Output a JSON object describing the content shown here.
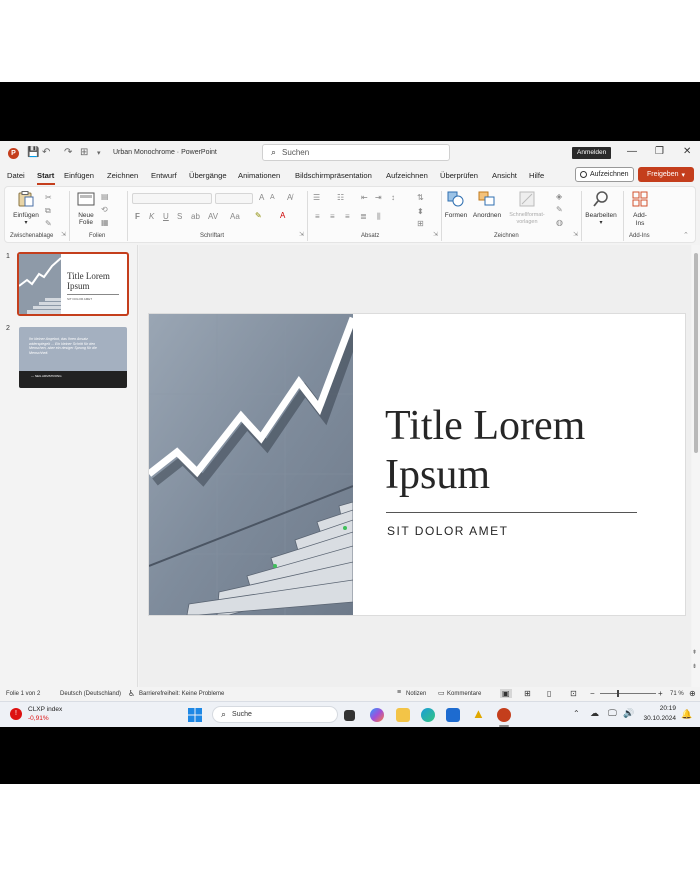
{
  "window": {
    "app_logo_letter": "P",
    "doc_title": "Urban Monochrome  ·  PowerPoint",
    "search_placeholder": "Suchen",
    "signin_label": "Anmelden",
    "minimize": "—",
    "maximize": "❐",
    "close": "✕"
  },
  "menu": {
    "tabs": [
      "Datei",
      "Start",
      "Einfügen",
      "Zeichnen",
      "Entwurf",
      "Übergänge",
      "Animationen",
      "Bildschirmpräsentation",
      "Aufzeichnen",
      "Überprüfen",
      "Ansicht",
      "Hilfe"
    ],
    "active_tab": "Start",
    "record_label": "Aufzeichnen",
    "share_label": "Freigeben"
  },
  "ribbon": {
    "paste_label": "Einfügen",
    "new_slide_label": "Neue Folie",
    "shapes_label": "Formen",
    "arrange_label": "Anordnen",
    "quick_styles_label": "Schnellformat-vorlagen",
    "edit_label": "Bearbeiten",
    "addins_label": "Add-Ins",
    "groups": {
      "clipboard": "Zwischenablage",
      "slides": "Folien",
      "font": "Schriftart",
      "paragraph": "Absatz",
      "drawing": "Zeichnen",
      "addins": "Add-Ins"
    },
    "font_buttons": [
      "F",
      "K",
      "U",
      "S"
    ]
  },
  "slides_panel": {
    "slide1": {
      "number": "1",
      "title": "Title Lorem Ipsum",
      "subtitle": "SIT DOLOR AMET"
    },
    "slide2": {
      "number": "2",
      "quote": "Ihr kleiner Angebot, das Ihren Ansatz widerspiegelt ... Ein kleiner Schritt für den Menschen, aber ein riesiger Sprung für die Menschheit.",
      "author": "— NEIL ARMSTRONG"
    }
  },
  "slide": {
    "title": "Title Lorem Ipsum",
    "title_line1": "Title Lorem",
    "title_line2": "Ipsum",
    "subtitle": "SIT DOLOR AMET"
  },
  "status": {
    "slide_count": "Folie 1 von 2",
    "language": "Deutsch (Deutschland)",
    "accessibility": "Barrierefreiheit: Keine Probleme",
    "notes": "Notizen",
    "comments": "Kommentare",
    "zoom": "71 %"
  },
  "taskbar": {
    "stock_name": "CLXP index",
    "stock_change": "-0,91%",
    "search_label": "Suche",
    "time": "20:19",
    "date": "30.10.2024"
  },
  "colors": {
    "accent": "#c43e1c",
    "slide2_bg": "#a4b0c0",
    "slide2_bar": "#222222"
  }
}
